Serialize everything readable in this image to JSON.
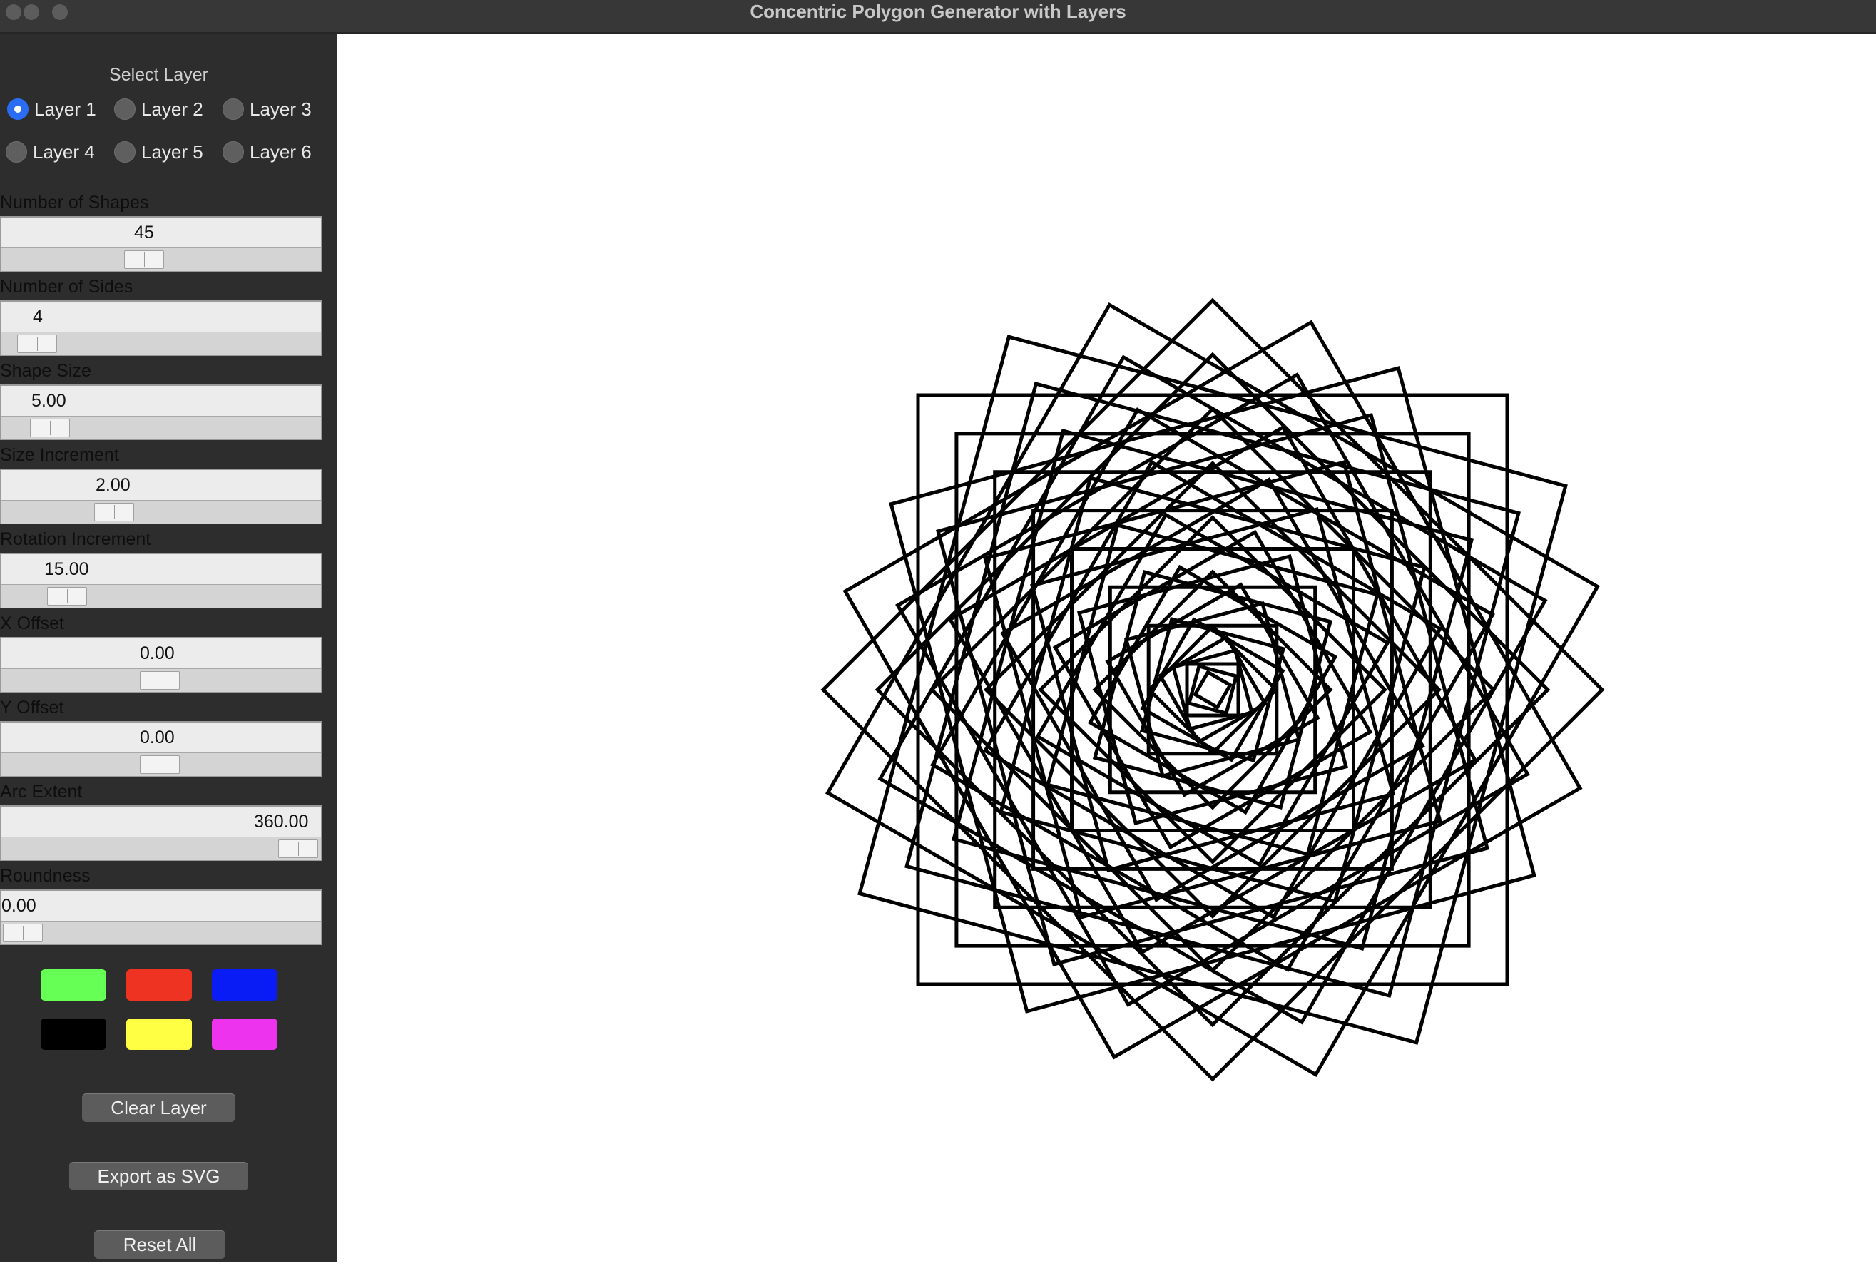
{
  "window": {
    "title": "Concentric Polygon Generator with Layers"
  },
  "layers": {
    "heading": "Select Layer",
    "options": [
      "Layer 1",
      "Layer 2",
      "Layer 3",
      "Layer 4",
      "Layer 5",
      "Layer 6"
    ],
    "selected_index": 0
  },
  "controls": [
    {
      "label": "Number of Shapes",
      "value": "45",
      "fraction": 0.45
    },
    {
      "label": "Number of Sides",
      "value": "4",
      "fraction": 0.05
    },
    {
      "label": "Shape Size",
      "value": "5.00",
      "fraction": 0.1
    },
    {
      "label": "Size Increment",
      "value": "2.00",
      "fraction": 0.33
    },
    {
      "label": "Rotation Increment",
      "value": "15.00",
      "fraction": 0.16
    },
    {
      "label": "X Offset",
      "value": "0.00",
      "fraction": 0.5
    },
    {
      "label": "Y Offset",
      "value": "0.00",
      "fraction": 0.5
    },
    {
      "label": "Arc Extent",
      "value": "360.00",
      "fraction": 1.0
    },
    {
      "label": "Roundness",
      "value": "0.00",
      "fraction": 0.0
    }
  ],
  "palette": [
    "#66ff55",
    "#ee3322",
    "#0a1cf5",
    "#000000",
    "#ffff44",
    "#ee33ee"
  ],
  "buttons": {
    "clear": "Clear Layer",
    "export": "Export as SVG",
    "reset": "Reset All"
  },
  "drawing": {
    "stroke_color": "#000000",
    "shape_count": 45,
    "sides": 4,
    "rotation_step_deg": 15
  }
}
